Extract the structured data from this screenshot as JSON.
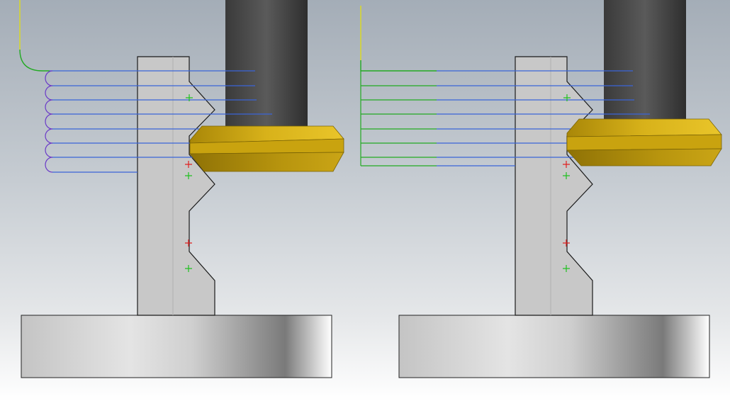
{
  "viewport": {
    "background_top": "#a4adb7",
    "background_bottom": "#ffffff"
  },
  "colors": {
    "part_fill": "#c8c8c8",
    "part_stroke": "#1a1a1a",
    "toolpath_cut": "#3a64d8",
    "toolpath_link": "#6a3ac8",
    "toolpath_lead": "#22aa22",
    "toolpath_approach": "#d6d630",
    "tool_shank": "#444444",
    "tool_insert": "#c9a30f",
    "marker_red": "#e02020",
    "marker_green": "#20c020"
  },
  "views": [
    {
      "id": "looped-toolpath",
      "link_style": "arc-loops",
      "pass_count": 8
    },
    {
      "id": "straight-return-toolpath",
      "link_style": "straight-lines",
      "pass_count": 8
    }
  ]
}
